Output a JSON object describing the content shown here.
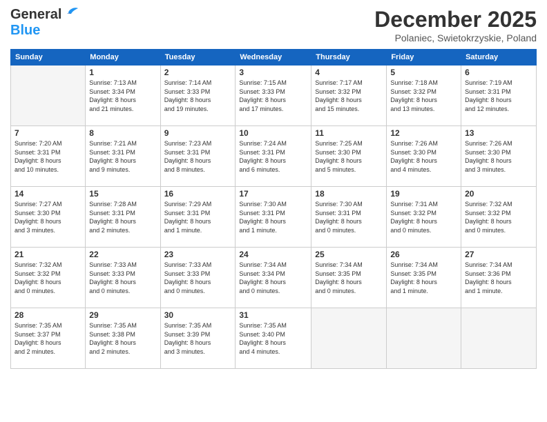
{
  "header": {
    "logo_general": "General",
    "logo_blue": "Blue",
    "title": "December 2025",
    "location": "Polaniec, Swietokrzyskie, Poland"
  },
  "days_of_week": [
    "Sunday",
    "Monday",
    "Tuesday",
    "Wednesday",
    "Thursday",
    "Friday",
    "Saturday"
  ],
  "weeks": [
    [
      {
        "day": "",
        "info": ""
      },
      {
        "day": "1",
        "info": "Sunrise: 7:13 AM\nSunset: 3:34 PM\nDaylight: 8 hours\nand 21 minutes."
      },
      {
        "day": "2",
        "info": "Sunrise: 7:14 AM\nSunset: 3:33 PM\nDaylight: 8 hours\nand 19 minutes."
      },
      {
        "day": "3",
        "info": "Sunrise: 7:15 AM\nSunset: 3:33 PM\nDaylight: 8 hours\nand 17 minutes."
      },
      {
        "day": "4",
        "info": "Sunrise: 7:17 AM\nSunset: 3:32 PM\nDaylight: 8 hours\nand 15 minutes."
      },
      {
        "day": "5",
        "info": "Sunrise: 7:18 AM\nSunset: 3:32 PM\nDaylight: 8 hours\nand 13 minutes."
      },
      {
        "day": "6",
        "info": "Sunrise: 7:19 AM\nSunset: 3:31 PM\nDaylight: 8 hours\nand 12 minutes."
      }
    ],
    [
      {
        "day": "7",
        "info": "Sunrise: 7:20 AM\nSunset: 3:31 PM\nDaylight: 8 hours\nand 10 minutes."
      },
      {
        "day": "8",
        "info": "Sunrise: 7:21 AM\nSunset: 3:31 PM\nDaylight: 8 hours\nand 9 minutes."
      },
      {
        "day": "9",
        "info": "Sunrise: 7:23 AM\nSunset: 3:31 PM\nDaylight: 8 hours\nand 8 minutes."
      },
      {
        "day": "10",
        "info": "Sunrise: 7:24 AM\nSunset: 3:31 PM\nDaylight: 8 hours\nand 6 minutes."
      },
      {
        "day": "11",
        "info": "Sunrise: 7:25 AM\nSunset: 3:30 PM\nDaylight: 8 hours\nand 5 minutes."
      },
      {
        "day": "12",
        "info": "Sunrise: 7:26 AM\nSunset: 3:30 PM\nDaylight: 8 hours\nand 4 minutes."
      },
      {
        "day": "13",
        "info": "Sunrise: 7:26 AM\nSunset: 3:30 PM\nDaylight: 8 hours\nand 3 minutes."
      }
    ],
    [
      {
        "day": "14",
        "info": "Sunrise: 7:27 AM\nSunset: 3:30 PM\nDaylight: 8 hours\nand 3 minutes."
      },
      {
        "day": "15",
        "info": "Sunrise: 7:28 AM\nSunset: 3:31 PM\nDaylight: 8 hours\nand 2 minutes."
      },
      {
        "day": "16",
        "info": "Sunrise: 7:29 AM\nSunset: 3:31 PM\nDaylight: 8 hours\nand 1 minute."
      },
      {
        "day": "17",
        "info": "Sunrise: 7:30 AM\nSunset: 3:31 PM\nDaylight: 8 hours\nand 1 minute."
      },
      {
        "day": "18",
        "info": "Sunrise: 7:30 AM\nSunset: 3:31 PM\nDaylight: 8 hours\nand 0 minutes."
      },
      {
        "day": "19",
        "info": "Sunrise: 7:31 AM\nSunset: 3:32 PM\nDaylight: 8 hours\nand 0 minutes."
      },
      {
        "day": "20",
        "info": "Sunrise: 7:32 AM\nSunset: 3:32 PM\nDaylight: 8 hours\nand 0 minutes."
      }
    ],
    [
      {
        "day": "21",
        "info": "Sunrise: 7:32 AM\nSunset: 3:32 PM\nDaylight: 8 hours\nand 0 minutes."
      },
      {
        "day": "22",
        "info": "Sunrise: 7:33 AM\nSunset: 3:33 PM\nDaylight: 8 hours\nand 0 minutes."
      },
      {
        "day": "23",
        "info": "Sunrise: 7:33 AM\nSunset: 3:33 PM\nDaylight: 8 hours\nand 0 minutes."
      },
      {
        "day": "24",
        "info": "Sunrise: 7:34 AM\nSunset: 3:34 PM\nDaylight: 8 hours\nand 0 minutes."
      },
      {
        "day": "25",
        "info": "Sunrise: 7:34 AM\nSunset: 3:35 PM\nDaylight: 8 hours\nand 0 minutes."
      },
      {
        "day": "26",
        "info": "Sunrise: 7:34 AM\nSunset: 3:35 PM\nDaylight: 8 hours\nand 1 minute."
      },
      {
        "day": "27",
        "info": "Sunrise: 7:34 AM\nSunset: 3:36 PM\nDaylight: 8 hours\nand 1 minute."
      }
    ],
    [
      {
        "day": "28",
        "info": "Sunrise: 7:35 AM\nSunset: 3:37 PM\nDaylight: 8 hours\nand 2 minutes."
      },
      {
        "day": "29",
        "info": "Sunrise: 7:35 AM\nSunset: 3:38 PM\nDaylight: 8 hours\nand 2 minutes."
      },
      {
        "day": "30",
        "info": "Sunrise: 7:35 AM\nSunset: 3:39 PM\nDaylight: 8 hours\nand 3 minutes."
      },
      {
        "day": "31",
        "info": "Sunrise: 7:35 AM\nSunset: 3:40 PM\nDaylight: 8 hours\nand 4 minutes."
      },
      {
        "day": "",
        "info": ""
      },
      {
        "day": "",
        "info": ""
      },
      {
        "day": "",
        "info": ""
      }
    ]
  ]
}
